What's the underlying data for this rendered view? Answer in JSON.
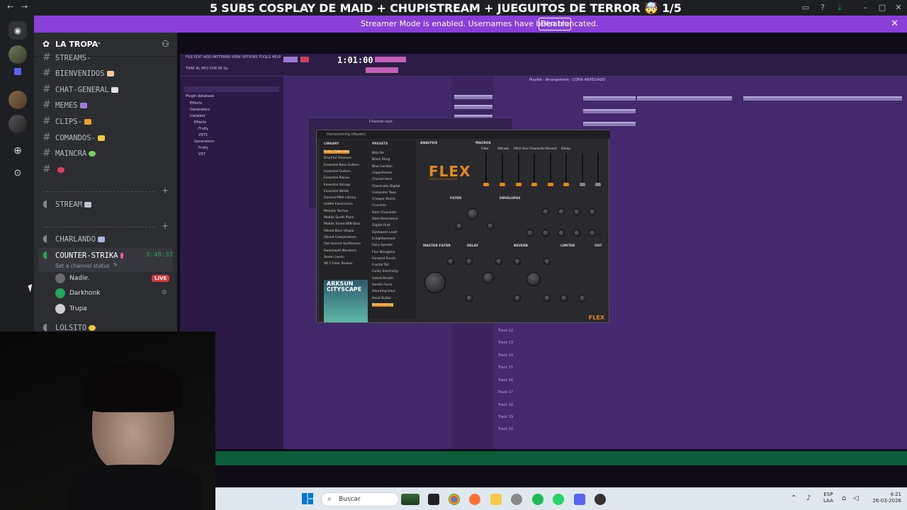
{
  "window": {
    "title": "5 SUBS COSPLAY DE MAID + CHUPISTREAM + JUEGUITOS DE TERROR 🤯 1/5"
  },
  "banner": {
    "message": "Streamer Mode is enabled. Usernames have been truncated.",
    "disable_label": "Disable",
    "color": "#8b3fd9"
  },
  "server": {
    "name": "LA TROPA"
  },
  "channels": [
    {
      "name": "STREAMS-",
      "type": "text"
    },
    {
      "name": "BIENVENIDOS",
      "type": "text"
    },
    {
      "name": "CHAT-GENERAL",
      "type": "text"
    },
    {
      "name": "MEMES",
      "type": "text"
    },
    {
      "name": "CLIPS-",
      "type": "text"
    },
    {
      "name": "COMANDOS-",
      "type": "text"
    },
    {
      "name": "MAINCRA",
      "type": "text"
    },
    {
      "name": "",
      "type": "text"
    }
  ],
  "stream_channel": {
    "name": "STREAM"
  },
  "voice_channels": {
    "charlando": "CHARLANDO",
    "counter": "COUNTER-STRIKA",
    "timer": "3:48:33",
    "status": "Set a channel status",
    "lolsito": "LOLSITO"
  },
  "voice_members": [
    {
      "name": "Nadie.",
      "badge": "LIVE"
    },
    {
      "name": "Darkhonk",
      "badge": ""
    },
    {
      "name": "Trupa",
      "badge": ""
    }
  ],
  "fl": {
    "menu": "FILE EDIT ADD PATTERNS VIEW OPTIONS TOOLS HELP",
    "time": "1:01:00",
    "project": "TRAP AL PEO POR MI Sp",
    "browser_items": [
      "Plugin database",
      "Effects",
      "Generators",
      "Installed",
      "Effects",
      "Fruity",
      "VST3",
      "Generators",
      "Fruity",
      "VST"
    ],
    "playlist_title": "Playlist - Arrangement - COPIA ARPEGIADO",
    "tracks": [
      "Track 12",
      "Track 13",
      "Track 14",
      "Track 15",
      "Track 16",
      "Track 17",
      "Track 18",
      "Track 19",
      "Track 20"
    ],
    "channel_rack": "Channel rack"
  },
  "flex": {
    "window_title": "Homecoming (Master)",
    "logo": "FLEX",
    "logo_sub": "advanced polysynth",
    "library_label": "LIBRARY",
    "presets_label": "PRESETS",
    "categories": [
      "Fruity Collection",
      "Drumful Treasure",
      "Essential Bass Guitars",
      "Essential Guitars",
      "Essential Pianos",
      "Essential Strings",
      "Essential Winds",
      "General Midi Library",
      "Hiddle Electronica",
      "Melodic Techno",
      "Mobile Synth Pluck",
      "Mobile Tuned 808 Bass",
      "Obsed Bass Utopia",
      "Obsed Compendium",
      "Owl Sonnet Synthwave",
      "Swankwolf Monsters",
      "Seven Leven",
      "Sft 1 Floor Shakes"
    ],
    "presets": [
      "Bitis Re",
      "Black Sting",
      "Blue Cordian",
      "Capacitation",
      "Chariot Horn",
      "Classically Digital",
      "Computer Tape",
      "Creeper Drone",
      "Crunchie",
      "Dark Chocolate",
      "Dark Resonance",
      "Digital Rust",
      "Dystopian Lead",
      "Enlightenment",
      "Fairy Sparkle",
      "Flux Navigator",
      "Forward Punch",
      "Fractal Tail",
      "Funky Electricity",
      "Gated Breath",
      "Gentle Force",
      "Haunting Hour",
      "Head Butter",
      "Homecoming"
    ],
    "sections": [
      "ANALYSIS",
      "MACROS",
      "FILTER",
      "ENVELOPES",
      "MASTER FILTER",
      "DELAY",
      "REVERB",
      "LIMITER",
      "OUT"
    ],
    "macros": [
      "Filter",
      "Vibrato",
      "Pitch Env",
      "Character",
      "Reverb",
      "Delay"
    ],
    "cover": "ARKSUN CITYSCAPE",
    "brand": "FLEX",
    "accent": "#e08a1e"
  },
  "taskbar": {
    "search_placeholder": "Buscar",
    "lang": "ESP",
    "lang2": "LAA",
    "time": "4:21",
    "date": "26-03-2026"
  }
}
